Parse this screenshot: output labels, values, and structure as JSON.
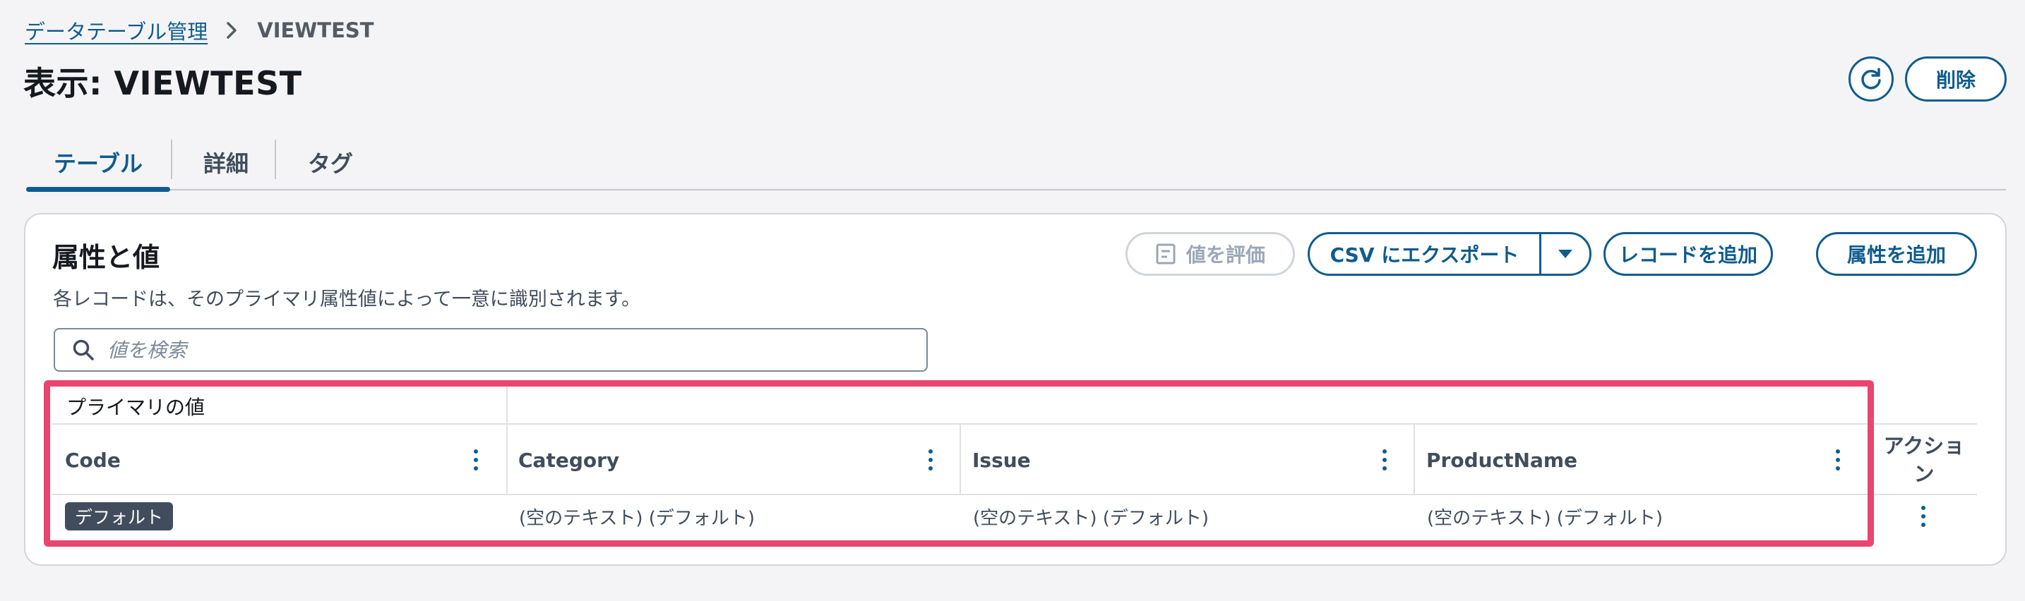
{
  "breadcrumb": {
    "parent": "データテーブル管理",
    "current": "VIEWTEST"
  },
  "page": {
    "title": "表示: VIEWTEST",
    "delete_label": "削除"
  },
  "tabs": [
    {
      "label": "テーブル",
      "active": true
    },
    {
      "label": "詳細",
      "active": false
    },
    {
      "label": "タグ",
      "active": false
    }
  ],
  "panel": {
    "title": "属性と値",
    "description": "各レコードは、そのプライマリ属性値によって一意に識別されます。",
    "buttons": {
      "evaluate": "値を評価",
      "export_csv": "CSV にエクスポート",
      "add_record": "レコードを追加",
      "add_attribute": "属性を追加"
    },
    "search_placeholder": "値を検索"
  },
  "table": {
    "primary_group_label": "プライマリの値",
    "columns": [
      "Code",
      "Category",
      "Issue",
      "ProductName"
    ],
    "actions_header": "アクション",
    "rows": [
      {
        "code_badge": "デフォルト",
        "category": "(空のテキスト) (デフォルト)",
        "issue": "(空のテキスト) (デフォルト)",
        "product_name": "(空のテキスト) (デフォルト)"
      }
    ]
  },
  "colors": {
    "accent": "#0f5c8e",
    "highlight": "#e8466e",
    "badge_bg": "#414d5c"
  }
}
